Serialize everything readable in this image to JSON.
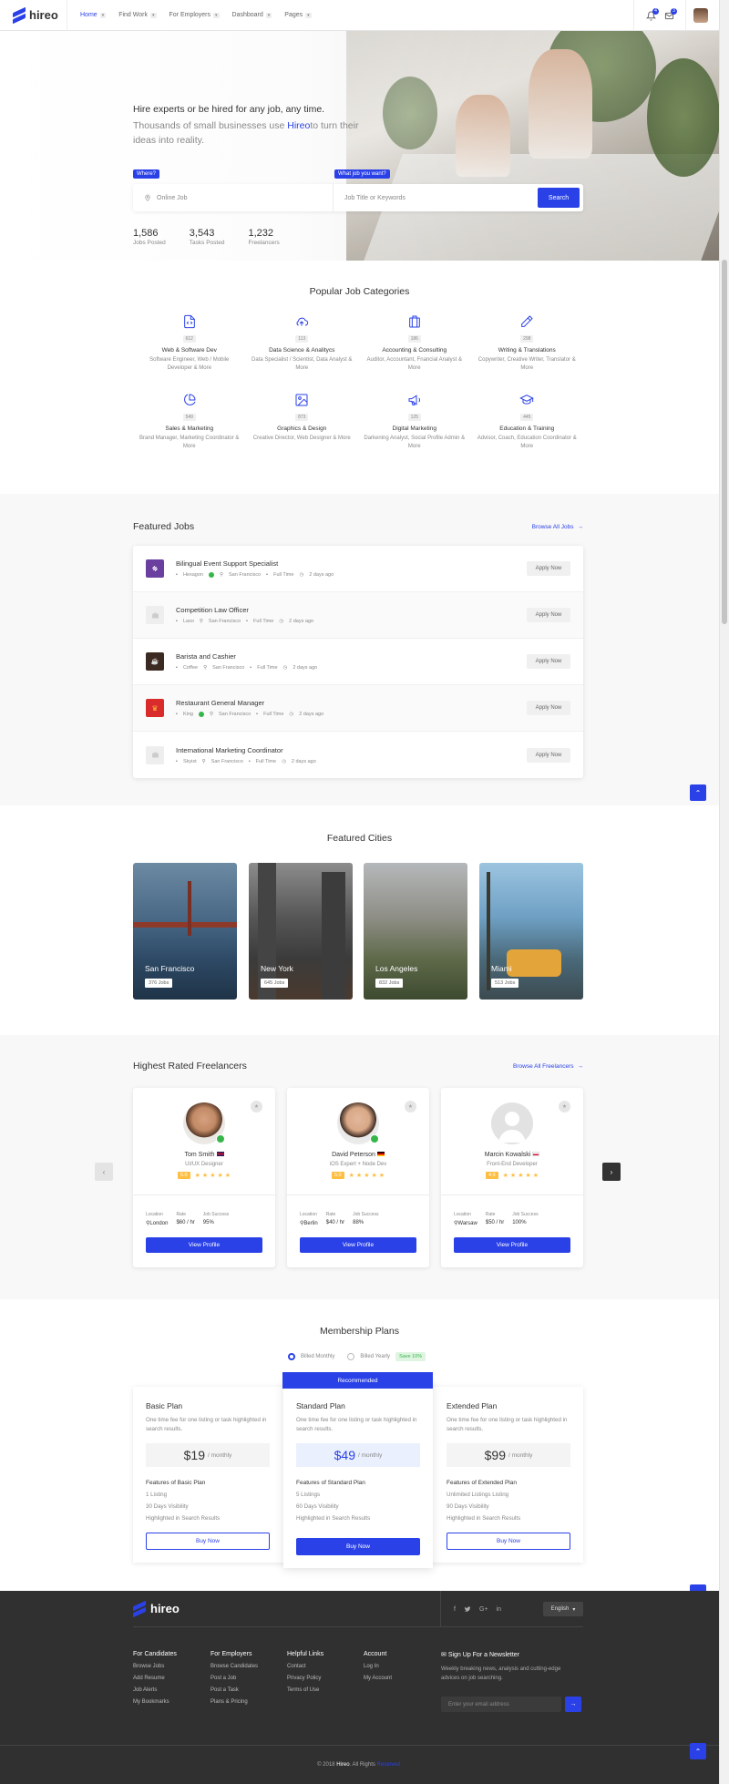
{
  "header": {
    "logo": "hireo",
    "nav": [
      "Home",
      "Find Work",
      "For Employers",
      "Dashboard",
      "Pages"
    ],
    "notif_count": "4",
    "msg_count": "3"
  },
  "hero": {
    "title": "Hire experts or be hired for any job, any time.",
    "sub_before": "Thousands of small businesses use ",
    "brand": "Hireo",
    "sub_after": "to turn their ideas into reality.",
    "where_tag": "Where?",
    "what_tag": "What job you want?",
    "where_placeholder": "Online Job",
    "what_placeholder": "Job Title or Keywords",
    "search_label": "Search",
    "stats": [
      {
        "num": "1,586",
        "label": "Jobs Posted"
      },
      {
        "num": "3,543",
        "label": "Tasks Posted"
      },
      {
        "num": "1,232",
        "label": "Freelancers"
      }
    ]
  },
  "categories": {
    "title": "Popular Job Categories",
    "items": [
      {
        "icon": "file-code-icon",
        "count": "612",
        "name": "Web & Software Dev",
        "desc": "Software Engineer, Web / Mobile Developer & More"
      },
      {
        "icon": "cloud-upload-icon",
        "count": "113",
        "name": "Data Science & Analitycs",
        "desc": "Data Specialist / Scientist, Data Analyst & More"
      },
      {
        "icon": "suitcase-icon",
        "count": "186",
        "name": "Accounting & Consulting",
        "desc": "Auditor, Accountant, Fnancial Analyst & More"
      },
      {
        "icon": "pencil-icon",
        "count": "298",
        "name": "Writing & Translations",
        "desc": "Copywriter, Creative Writer, Translator & More"
      },
      {
        "icon": "pie-chart-icon",
        "count": "549",
        "name": "Sales & Marketing",
        "desc": "Brand Manager, Marketing Coordinator & More"
      },
      {
        "icon": "image-icon",
        "count": "873",
        "name": "Graphics & Design",
        "desc": "Creative Director, Web Designer & More"
      },
      {
        "icon": "megaphone-icon",
        "count": "125",
        "name": "Digital Marketing",
        "desc": "Darkening Analyst, Social Profile Admin & More"
      },
      {
        "icon": "graduation-cap-icon",
        "count": "445",
        "name": "Education & Training",
        "desc": "Advisor, Coach, Education Coordinator & More"
      }
    ]
  },
  "featured_jobs": {
    "title": "Featured Jobs",
    "browse": "Browse All Jobs",
    "apply_label": "Apply Now",
    "jobs": [
      {
        "title": "Bilingual Event Support Specialist",
        "company": "Hexagon",
        "verified": true,
        "location": "San Francisco",
        "type": "Full Time",
        "posted": "2 days ago",
        "logo_color": "#6b3fa0"
      },
      {
        "title": "Competition Law Officer",
        "company": "Laxo",
        "verified": false,
        "location": "San Francisco",
        "type": "Full Time",
        "posted": "2 days ago",
        "logo_color": "#e9e9e9"
      },
      {
        "title": "Barista and Cashier",
        "company": "Coffee",
        "verified": false,
        "location": "San Francisco",
        "type": "Full Time",
        "posted": "2 days ago",
        "logo_color": "#3b2a22"
      },
      {
        "title": "Restaurant General Manager",
        "company": "King",
        "verified": true,
        "location": "San Francisco",
        "type": "Full Time",
        "posted": "2 days ago",
        "logo_color": "#d92b2b"
      },
      {
        "title": "International Marketing Coordinator",
        "company": "Skyist",
        "verified": false,
        "location": "San Francisco",
        "type": "Full Time",
        "posted": "2 days ago",
        "logo_color": "#e9e9e9"
      }
    ]
  },
  "cities": {
    "title": "Featured Cities",
    "items": [
      {
        "name": "San Francisco",
        "count": "376 Jobs"
      },
      {
        "name": "New York",
        "count": "645 Jobs"
      },
      {
        "name": "Los Angeles",
        "count": "832 Jobs"
      },
      {
        "name": "Miami",
        "count": "513 Jobs"
      }
    ]
  },
  "freelancers": {
    "title": "Highest Rated Freelancers",
    "browse": "Browse All Freelancers",
    "view_label": "View Profile",
    "labels": {
      "location": "Location",
      "rate": "Rate",
      "success": "Job Success"
    },
    "items": [
      {
        "name": "Tom Smith",
        "role": "UI/UX Designer",
        "rating": "5.0",
        "location": "London",
        "rate": "$60 / hr",
        "success": "95%",
        "verified": true
      },
      {
        "name": "David Peterson",
        "role": "iOS Expert + Node Dev",
        "rating": "5.0",
        "location": "Berlin",
        "rate": "$40 / hr",
        "success": "88%",
        "verified": true
      },
      {
        "name": "Marcin Kowalski",
        "role": "Front-End Developer",
        "rating": "4.9",
        "location": "Warsaw",
        "rate": "$50 / hr",
        "success": "100%",
        "verified": false
      }
    ]
  },
  "membership": {
    "title": "Membership Plans",
    "billed_monthly": "Billed Monthly",
    "billed_yearly": "Billed Yearly",
    "save": "Save 10%",
    "recommended": "Recommended",
    "buy_label": "Buy Now",
    "per": "/ monthly",
    "plans": [
      {
        "name": "Basic Plan",
        "desc": "One time fee for one listing or task highlighted in search results.",
        "price": "$19",
        "feat_title": "Features of Basic Plan",
        "features": [
          "1 Listing",
          "30 Days Visibility",
          "Highlighted in Search Results"
        ]
      },
      {
        "name": "Standard Plan",
        "desc": "One time fee for one listing or task highlighted in search results.",
        "price": "$49",
        "feat_title": "Features of Standard Plan",
        "features": [
          "5 Listings",
          "60 Days Visibility",
          "Highlighted in Search Results"
        ]
      },
      {
        "name": "Extended Plan",
        "desc": "One time fee for one listing or task highlighted in search results.",
        "price": "$99",
        "feat_title": "Features of Extended Plan",
        "features": [
          "Unlimited Listings Listing",
          "90 Days Visibility",
          "Highlighted in Search Results"
        ]
      }
    ]
  },
  "footer": {
    "logo": "hireo",
    "language": "English",
    "social": [
      "f",
      "t",
      "G+",
      "in"
    ],
    "columns": [
      {
        "title": "For Candidates",
        "links": [
          "Browse Jobs",
          "Add Resume",
          "Job Alerts",
          "My Bookmarks"
        ]
      },
      {
        "title": "For Employers",
        "links": [
          "Browse Candidates",
          "Post a Job",
          "Post a Task",
          "Plans & Pricing"
        ]
      },
      {
        "title": "Helpful Links",
        "links": [
          "Contact",
          "Privacy Policy",
          "Terms of Use"
        ]
      },
      {
        "title": "Account",
        "links": [
          "Log In",
          "My Account"
        ]
      }
    ],
    "newsletter_title": "Sign Up For a Newsletter",
    "newsletter_desc": "Weekly breaking news, analysis and cutting-edge advices on job searching.",
    "newsletter_placeholder": "Enter your email address",
    "copyright_pre": "© 2018 ",
    "copyright_brand": "Hireo",
    "copyright_mid": ". All Rights ",
    "copyright_link": "Reserved."
  }
}
